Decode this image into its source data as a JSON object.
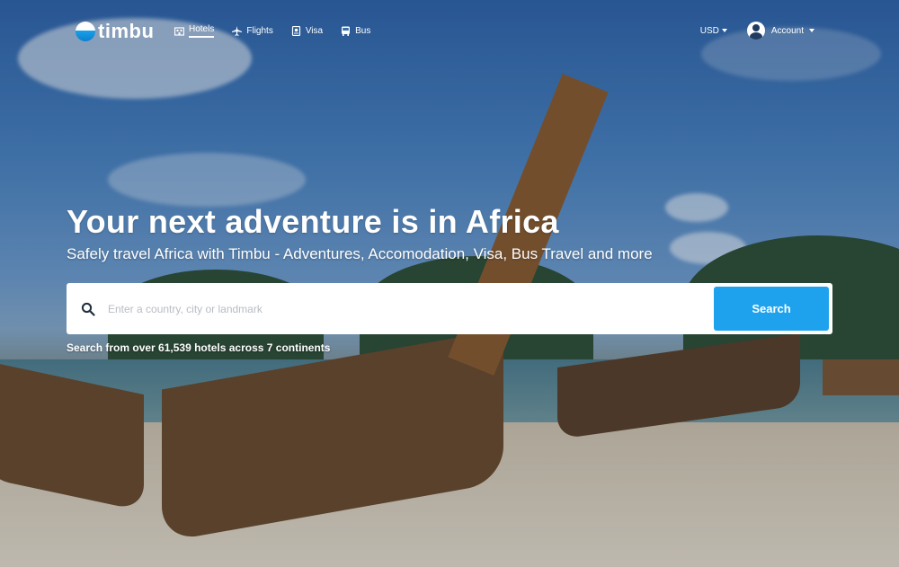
{
  "brand": {
    "name": "timbu"
  },
  "nav": {
    "items": [
      {
        "label": "Hotels",
        "icon": "hotel-icon",
        "active": true
      },
      {
        "label": "Flights",
        "icon": "plane-icon",
        "active": false
      },
      {
        "label": "Visa",
        "icon": "passport-icon",
        "active": false
      },
      {
        "label": "Bus",
        "icon": "bus-icon",
        "active": false
      }
    ],
    "currency": "USD",
    "account": "Account"
  },
  "hero": {
    "title": "Your next adventure is in Africa",
    "subtitle": "Safely travel Africa with Timbu - Adventures, Accomodation, Visa, Bus Travel and more"
  },
  "search": {
    "placeholder": "Enter a country, city or landmark",
    "value": "",
    "button_label": "Search",
    "stats": "Search from over 61,539 hotels across 7 continents"
  },
  "colors": {
    "accent": "#1ea2ee",
    "text_on_hero": "#ffffff"
  }
}
